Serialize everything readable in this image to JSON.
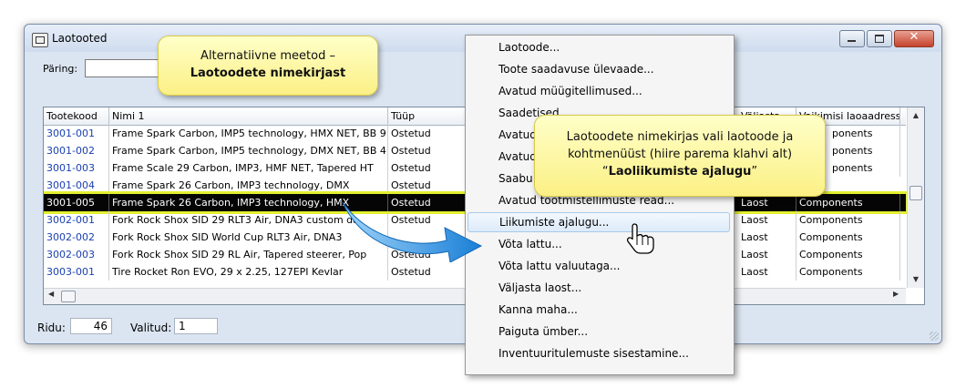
{
  "window": {
    "title": "Laotooted"
  },
  "query": {
    "label": "Päring:",
    "value": ""
  },
  "table": {
    "headers": [
      "Tootekood",
      "Nimi 1",
      "Tüüp",
      "Väljasta",
      "Vaikimisi laoaadress"
    ],
    "rows": [
      {
        "code": "3001-001",
        "name": "Frame Spark Carbon, IMP5 technology, HMX NET, BB 9",
        "type": "Ostetud",
        "issue": "",
        "address": ""
      },
      {
        "code": "3001-002",
        "name": "Frame Spark Carbon, IMP5 technology, DMX NET, BB 4",
        "type": "Ostetud",
        "issue": "",
        "address": ""
      },
      {
        "code": "3001-003",
        "name": "Frame Scale 29 Carbon, IMP3, HMF NET, Tapered HT",
        "type": "Ostetud",
        "issue": "",
        "address": ""
      },
      {
        "code": "3001-004",
        "name": "Frame Spark 26 Carbon, IMP3 technology, DMX",
        "type": "Ostetud",
        "issue": "",
        "address": ""
      },
      {
        "code": "3001-005",
        "name": "Frame Spark 26 Carbon, IMP3 technology, HMX",
        "type": "Ostetud",
        "issue": "Laost",
        "address": "Components"
      },
      {
        "code": "3002-001",
        "name": "Fork Rock Shox SID 29 RLT3 Air, DNA3 custom da",
        "type": "Ostetud",
        "issue": "Laost",
        "address": "Components"
      },
      {
        "code": "3002-002",
        "name": "Fork Rock Shox SID World Cup RLT3 Air, DNA3",
        "type": "",
        "issue": "Laost",
        "address": "Components"
      },
      {
        "code": "3002-003",
        "name": "Fork Rock Shox SID 29 RL Air, Tapered steerer, Pop",
        "type": "Ostetud",
        "issue": "Laost",
        "address": "Components"
      },
      {
        "code": "3003-001",
        "name": "Tire Rocket Ron EVO, 29 x 2.25, 127EPI Kevlar",
        "type": "Ostetud",
        "issue": "Laost",
        "address": "Components"
      }
    ],
    "visible_right_fragments": [
      "ponents",
      "ponents",
      "ponents"
    ]
  },
  "status": {
    "rows_label": "Ridu:",
    "rows_value": "46",
    "selected_label": "Valitud:",
    "selected_value": "1"
  },
  "menu": {
    "items": [
      "Laotoode...",
      "Toote saadavuse ülevaade...",
      "Avatud müügitellimused...",
      "Saadetised...",
      "Avatud",
      "Avatud",
      "Saabu",
      "Avatud tootmistellimuste read...",
      "Liikumiste ajalugu...",
      "Võta lattu...",
      "Võta lattu valuutaga...",
      "Väljasta laost...",
      "Kanna maha...",
      "Paiguta ümber...",
      "Inventuuritulemuste sisestamine..."
    ],
    "highlighted_index": 8
  },
  "callouts": {
    "first": {
      "line1": "Alternatiivne meetod –",
      "line2": "Laotoodete nimekirjast"
    },
    "second": {
      "line1": "Laotoodete nimekirjas vali laotoode ja",
      "line2": "kohtmenüüst (hiire parema klahvi alt)",
      "line3a": "“",
      "line3b": "Laoliikumiste ajalugu",
      "line3c": "”"
    }
  },
  "colors": {
    "selected_row_bg": "#050505",
    "selected_row_glow": "#e3ef2f",
    "code_link": "#1a3fb0",
    "callout_fill": "#fbf085",
    "arrow_fill": "#2b8fe0"
  },
  "icons": {
    "window_icon": "app-icon",
    "cursor": "hand-pointer-icon",
    "arrow": "curved-arrow-icon"
  }
}
